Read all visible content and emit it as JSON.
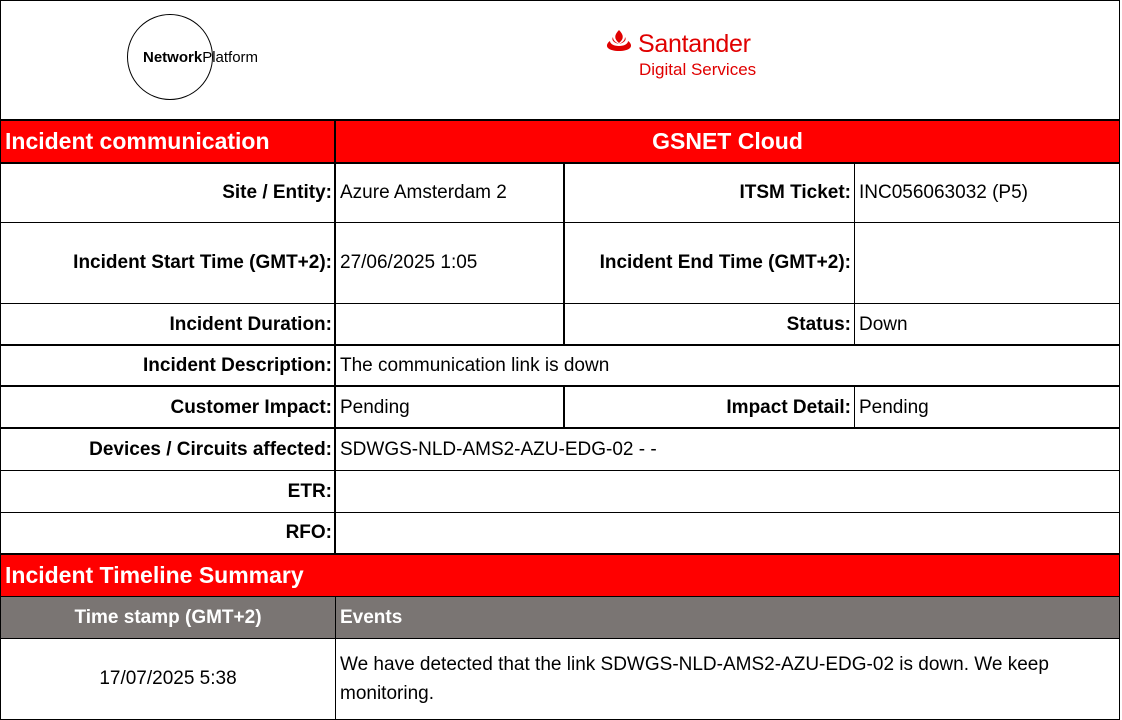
{
  "logos": {
    "network_platform": {
      "bold": "Network",
      "regular": "Platform"
    },
    "santander": {
      "name": "Santander",
      "sub": "Digital Services",
      "color": "#e00000"
    }
  },
  "header": {
    "title": "Incident communication",
    "service": "GSNET Cloud"
  },
  "fields": {
    "site_label": "Site / Entity:",
    "site_value": "Azure Amsterdam 2",
    "itsm_label": "ITSM Ticket:",
    "itsm_value": "INC056063032 (P5)",
    "start_label": "Incident Start Time (GMT+2):",
    "start_value": "27/06/2025 1:05",
    "end_label": "Incident End Time (GMT+2):",
    "end_value": "",
    "duration_label": "Incident Duration:",
    "duration_value": "",
    "status_label": "Status:",
    "status_value": "Down",
    "description_label": "Incident Description:",
    "description_value": "The communication link is down",
    "impact_label": "Customer Impact:",
    "impact_value": "Pending",
    "impact_detail_label": "Impact Detail:",
    "impact_detail_value": "Pending",
    "devices_label": "Devices / Circuits affected:",
    "devices_value": "SDWGS-NLD-AMS2-AZU-EDG-02 - -",
    "etr_label": "ETR:",
    "etr_value": "",
    "rfo_label": "RFO:",
    "rfo_value": ""
  },
  "timeline": {
    "title": "Incident Timeline Summary",
    "col_time": "Time stamp (GMT+2)",
    "col_events": "Events",
    "rows": [
      {
        "time": "17/07/2025 5:38",
        "event": "We have detected that the link SDWGS-NLD-AMS2-AZU-EDG-02 is down. We keep monitoring."
      }
    ]
  },
  "colors": {
    "accent_red": "#ff0000",
    "header_gray": "#7a7573"
  }
}
